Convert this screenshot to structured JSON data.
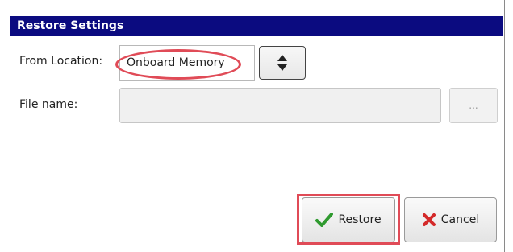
{
  "dialog": {
    "title": "Restore Settings"
  },
  "from_location": {
    "label": "From Location:",
    "value": "Onboard Memory",
    "spin_icon": "up-down-arrows-icon"
  },
  "file_name": {
    "label": "File name:",
    "value": "",
    "browse_label": "..."
  },
  "buttons": {
    "restore_label": "Restore",
    "restore_icon": "checkmark-icon",
    "cancel_label": "Cancel",
    "cancel_icon": "x-icon"
  },
  "colors": {
    "title_bar": "#0b0b80",
    "highlight": "#e04b57",
    "check_green": "#2f9a2f",
    "cancel_red": "#d42a2a"
  }
}
